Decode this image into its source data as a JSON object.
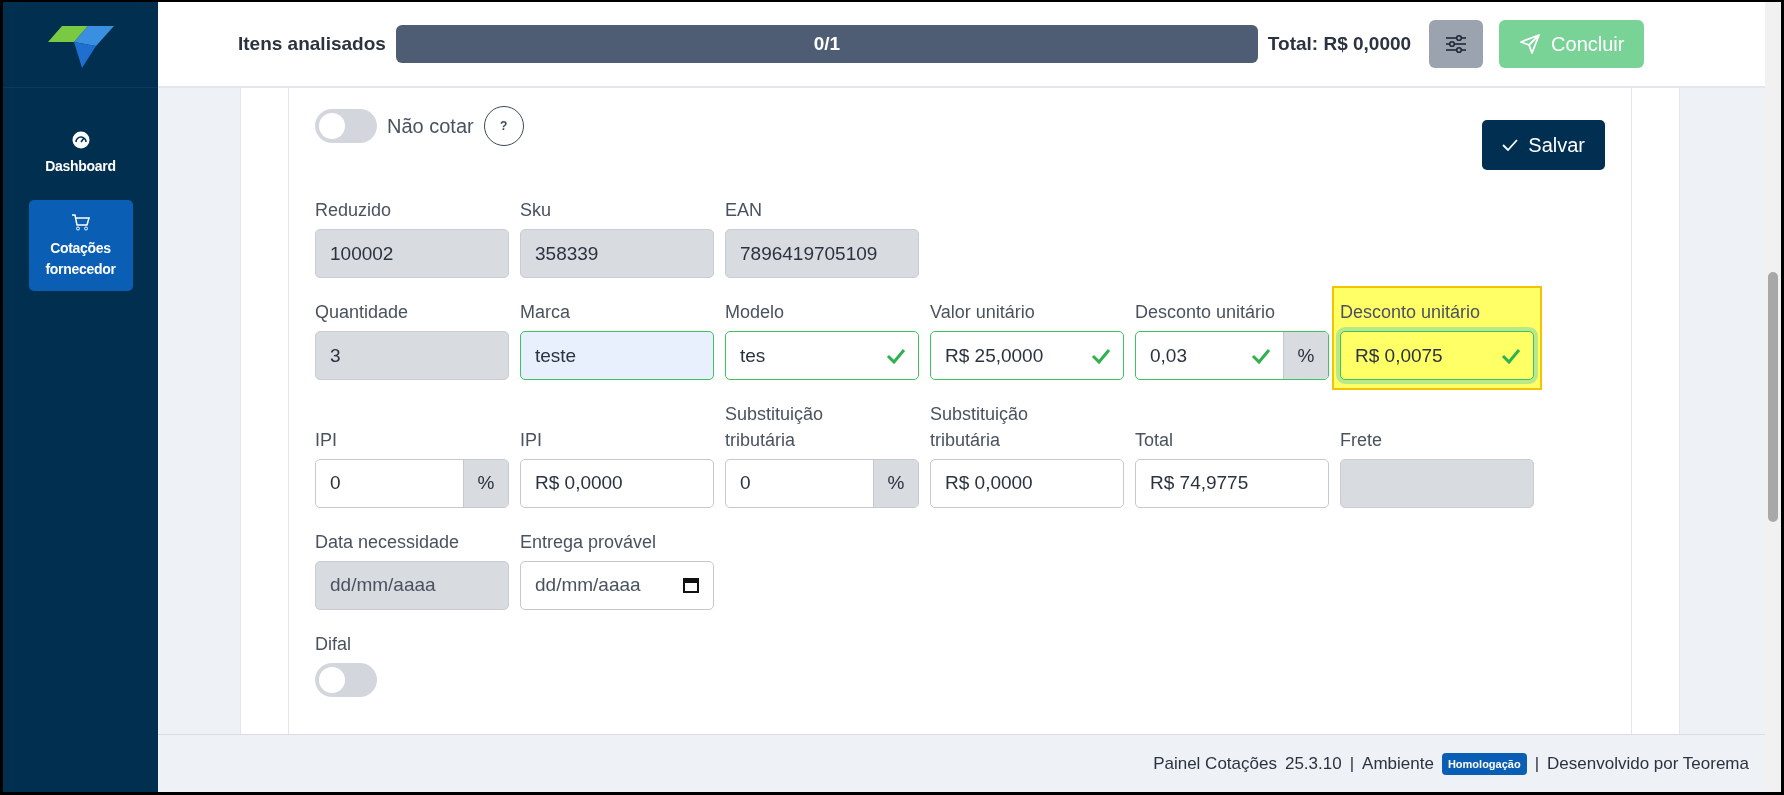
{
  "sidebar": {
    "items": [
      {
        "label": "Dashboard",
        "selected": false
      },
      {
        "label": "Cotações fornecedor",
        "selected": true
      }
    ]
  },
  "header": {
    "progress_label": "Itens analisados",
    "progress": {
      "text": "0/1",
      "level": 0
    },
    "total": "Total: R$ 0,0000",
    "concluir": {
      "label": "Concluir",
      "disabled": true
    }
  },
  "form": {
    "nao_cotar": {
      "label": "Não cotar",
      "on": false,
      "help": "?"
    },
    "save_button": "Salvar",
    "rows": [
      {
        "fields": [
          {
            "label": "Reduzido",
            "value": "100002",
            "kind": "readonly"
          },
          {
            "label": "Sku",
            "value": "358339",
            "kind": "readonly"
          },
          {
            "label": "EAN",
            "value": "7896419705109",
            "kind": "readonly"
          }
        ]
      },
      {
        "fields": [
          {
            "label": "Quantidade",
            "value": "3",
            "kind": "readonly"
          },
          {
            "label": "Marca",
            "value": "teste",
            "kind": "input",
            "valid": false,
            "autofilled": true
          },
          {
            "label": "Modelo",
            "value": "tes",
            "kind": "input",
            "valid": true,
            "autofilled": false
          },
          {
            "label": "Valor unitário",
            "value": "R$ 25,0000",
            "kind": "input",
            "valid": true,
            "autofilled": false
          },
          {
            "label": "Desconto unitário",
            "value": "0,03",
            "kind": "input",
            "valid": true,
            "autofilled": false,
            "suffix": "%"
          },
          {
            "label": "Desconto unitário",
            "value": "R$ 0,0075",
            "kind": "input",
            "valid": true,
            "autofilled": false,
            "highlighted": true
          }
        ]
      },
      {
        "fields": [
          {
            "label": "IPI",
            "value": "0",
            "kind": "input",
            "valid": false,
            "autofilled": false,
            "suffix": "%"
          },
          {
            "label": "IPI",
            "value": "R$ 0,0000",
            "kind": "input",
            "valid": false,
            "autofilled": false
          },
          {
            "label": "Substituição tributária",
            "value": "0",
            "kind": "input",
            "valid": false,
            "autofilled": false,
            "suffix": "%"
          },
          {
            "label": "Substituição tributária",
            "value": "R$ 0,0000",
            "kind": "input",
            "valid": false,
            "autofilled": false
          },
          {
            "label": "Total",
            "value": "R$ 74,9775",
            "kind": "input",
            "valid": false,
            "autofilled": false
          },
          {
            "label": "Frete",
            "kind": "readonly"
          }
        ]
      },
      {
        "fields": [
          {
            "label": "Data necessidade",
            "placeholder": "dd/mm/aaaa",
            "kind": "readonly"
          },
          {
            "label": "Entrega provável",
            "placeholder": "dd/mm/aaaa",
            "kind": "date"
          }
        ]
      }
    ],
    "difal": {
      "label": "Difal",
      "on": false
    }
  },
  "footer": {
    "app": "Painel Cotações",
    "version": "25.3.10",
    "separator_1": "|",
    "env_label": "Ambiente",
    "env_badge": "Homologação",
    "separator_2": "|",
    "credits": "Desenvolvido por Teorema"
  }
}
